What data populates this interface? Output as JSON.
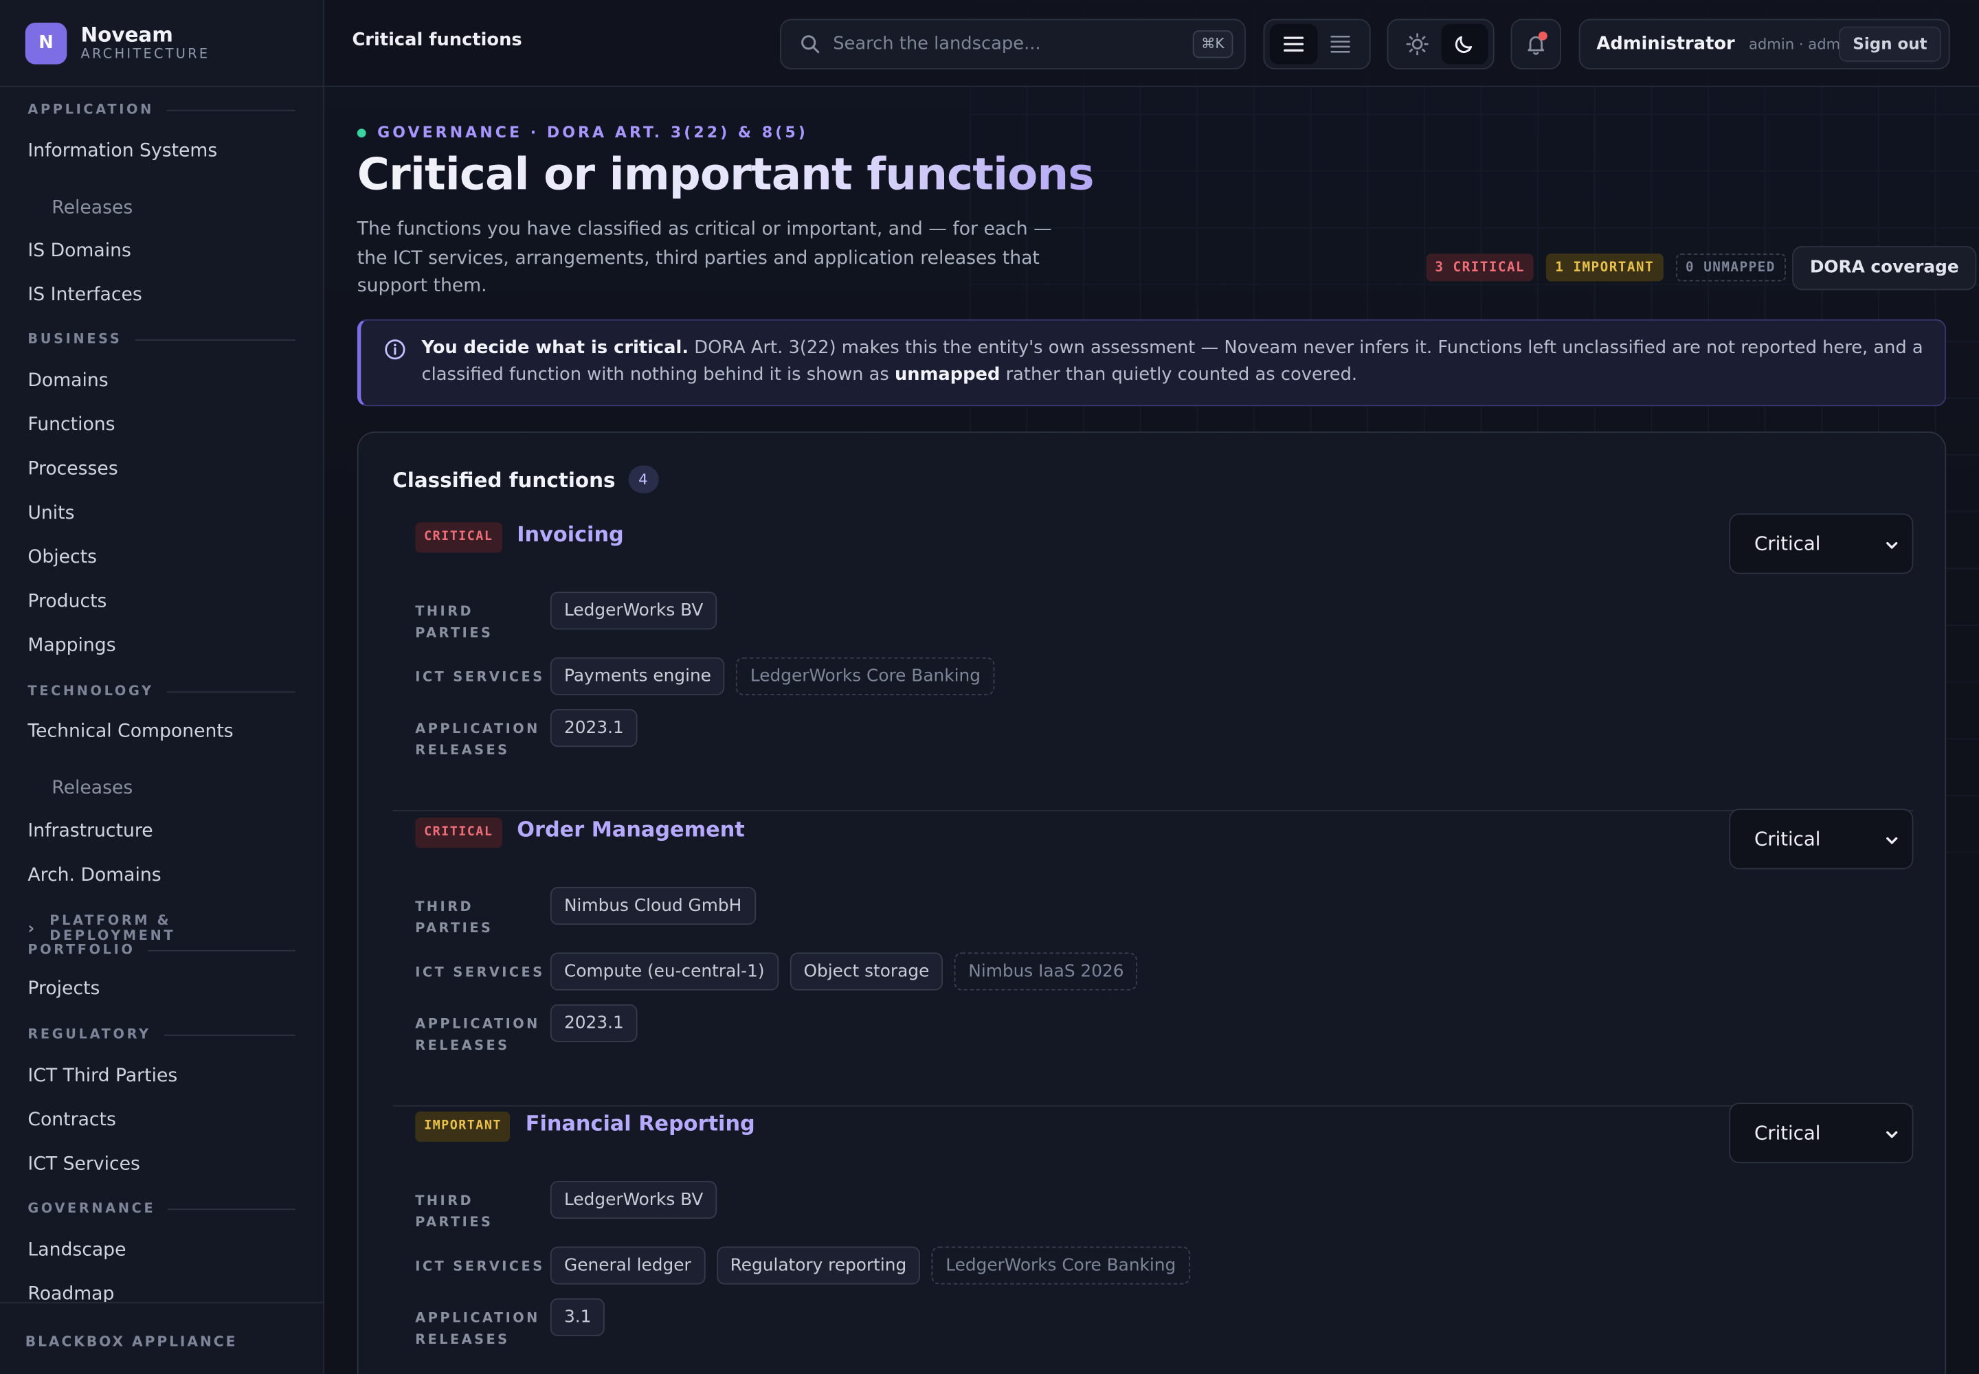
{
  "brand": {
    "name": "Noveam",
    "sub": "ARCHITECTURE",
    "logo_letter": "N"
  },
  "sidebar": {
    "sections": [
      {
        "title": "APPLICATION",
        "items": [
          {
            "label": "Information Systems"
          },
          {
            "label": "Releases",
            "sub": true
          },
          {
            "label": "IS Domains"
          },
          {
            "label": "IS Interfaces"
          }
        ]
      },
      {
        "title": "BUSINESS",
        "items": [
          {
            "label": "Domains"
          },
          {
            "label": "Functions"
          },
          {
            "label": "Processes"
          },
          {
            "label": "Units"
          },
          {
            "label": "Objects"
          },
          {
            "label": "Products"
          },
          {
            "label": "Mappings"
          }
        ]
      },
      {
        "title": "TECHNOLOGY",
        "items": [
          {
            "label": "Technical Components"
          },
          {
            "label": "Releases",
            "sub": true
          },
          {
            "label": "Infrastructure"
          },
          {
            "label": "Arch. Domains"
          }
        ]
      },
      {
        "title": "PLATFORM & DEPLOYMENT",
        "collapsed": true,
        "items": []
      },
      {
        "title": "PORTFOLIO",
        "items": [
          {
            "label": "Projects"
          }
        ]
      },
      {
        "title": "REGULATORY",
        "items": [
          {
            "label": "ICT Third Parties"
          },
          {
            "label": "Contracts"
          },
          {
            "label": "ICT Services"
          }
        ]
      },
      {
        "title": "GOVERNANCE",
        "items": [
          {
            "label": "Landscape"
          },
          {
            "label": "Roadmap"
          }
        ]
      }
    ],
    "footer": "BLACKBOX APPLIANCE"
  },
  "topbar": {
    "page_label": "Critical functions",
    "search_placeholder": "Search the landscape...",
    "search_shortcut": "⌘K",
    "user_name": "Administrator",
    "user_meta": "admin · admin",
    "sign_out": "Sign out",
    "has_notification": true
  },
  "header": {
    "eyebrow": "GOVERNANCE · DORA ART. 3(22) & 8(5)",
    "title": "Critical or important functions",
    "description": "The functions you have classified as critical or important, and — for each — the ICT services, arrangements, third parties and application releases that support them.",
    "badges": {
      "critical": "3 CRITICAL",
      "important": "1 IMPORTANT",
      "unmapped": "0 UNMAPPED"
    },
    "dora_button": "DORA coverage"
  },
  "info": {
    "lead": "You decide what is critical.",
    "text1": " DORA Art. 3(22) makes this the entity's own assessment — Noveam never infers it. Functions left unclassified are not reported here, and a classified function with nothing behind it is shown as ",
    "bold2": "unmapped",
    "text2": " rather than quietly counted as covered."
  },
  "card": {
    "title": "Classified functions",
    "count": "4"
  },
  "row_labels": {
    "third_parties": "THIRD PARTIES",
    "ict_services": "ICT SERVICES",
    "app_releases": "APPLICATION RELEASES"
  },
  "functions": [
    {
      "classification": "CRITICAL",
      "name": "Invoicing",
      "select": "Critical",
      "third_parties": [
        "LedgerWorks BV"
      ],
      "ict_services": [
        "Payments engine"
      ],
      "arrangements": [
        "LedgerWorks Core Banking"
      ],
      "releases": [
        "2023.1"
      ]
    },
    {
      "classification": "CRITICAL",
      "name": "Order Management",
      "select": "Critical",
      "third_parties": [
        "Nimbus Cloud GmbH"
      ],
      "ict_services": [
        "Compute (eu-central-1)",
        "Object storage"
      ],
      "arrangements": [
        "Nimbus IaaS 2026"
      ],
      "releases": [
        "2023.1"
      ]
    },
    {
      "classification": "IMPORTANT",
      "name": "Financial Reporting",
      "select": "Critical",
      "third_parties": [
        "LedgerWorks BV"
      ],
      "ict_services": [
        "General ledger",
        "Regulatory reporting"
      ],
      "arrangements": [
        "LedgerWorks Core Banking"
      ],
      "releases": [
        "3.1"
      ]
    }
  ],
  "colors": {
    "accent": "#7d6ee6",
    "critical": "#ef6f78",
    "important": "#e8c14a",
    "ok": "#38d39f"
  }
}
